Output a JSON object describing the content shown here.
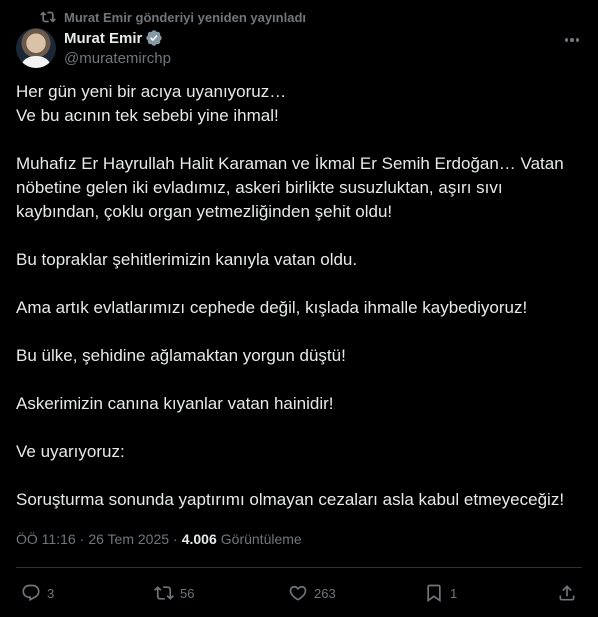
{
  "repost_banner": {
    "icon": "repost-icon",
    "text": "Murat Emir gönderiyi yeniden yayınladı"
  },
  "author": {
    "name": "Murat Emir",
    "handle": "@muratemirchp",
    "verified_color": "#1d9bf0"
  },
  "tweet": {
    "paragraphs": [
      "Her gün yeni bir acıya uyanıyoruz…",
      "Ve bu acının tek sebebi yine ihmal!",
      "Muhafız Er Hayrullah Halit Karaman ve İkmal Er Semih Erdoğan… Vatan",
      "nöbetine gelen iki evladımız, askeri birlikte susuzluktan, aşırı sıvı",
      "kaybından, çoklu organ yetmezliğinden şehit oldu!",
      "Bu topraklar şehitlerimizin kanıyla vatan oldu.",
      "Ama artık evlatlarımızı cephede değil, kışlada ihmalle kaybediyoruz!",
      "Bu ülke, şehidine ağlamaktan yorgun düştü!",
      "Askerimizin canına kıyanlar vatan hainidir!",
      "Ve uyarıyoruz:",
      "Soruşturma sonunda yaptırımı olmayan cezaları asla  kabul etmeyeceğiz!"
    ]
  },
  "meta": {
    "time": "ÖÖ 11:16",
    "separator": "·",
    "date": "26 Tem 2025",
    "views": "4.006",
    "views_label": "Görüntüleme"
  },
  "actions": {
    "replies": "3",
    "reposts": "56",
    "likes": "263",
    "bookmarks": "1"
  },
  "colors": {
    "background": "#000000",
    "text": "#e7e9ea",
    "muted": "#71767b",
    "accent": "#1d9bf0"
  }
}
